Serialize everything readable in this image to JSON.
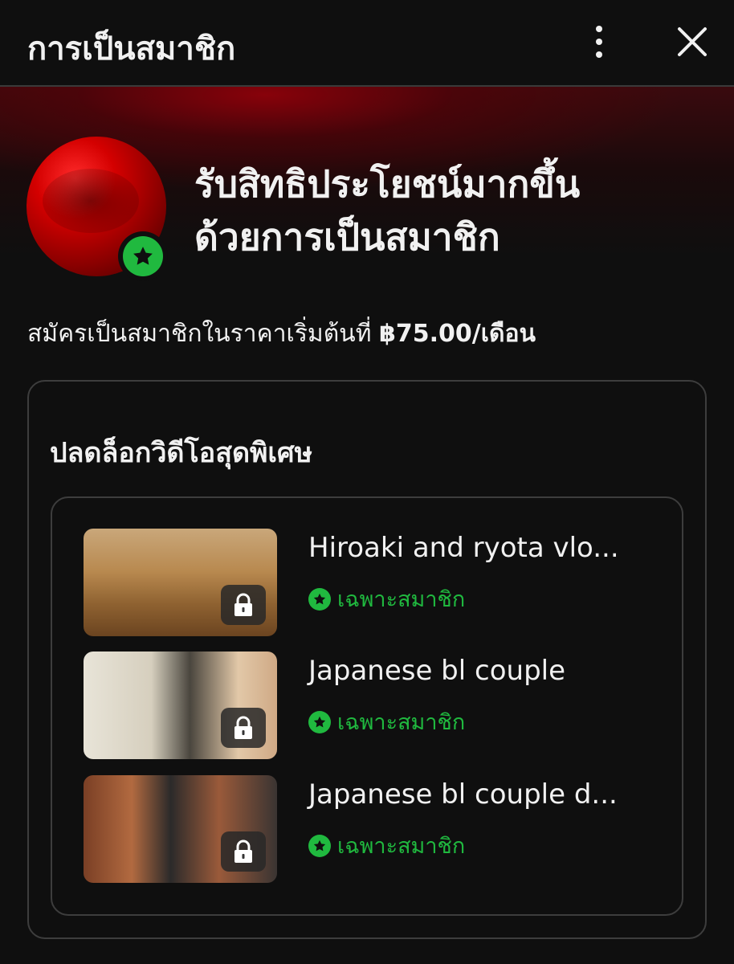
{
  "header": {
    "title": "การเป็นสมาชิก",
    "more_icon": "more-vertical-icon",
    "close_icon": "close-icon"
  },
  "hero": {
    "headline_line1": "รับสิทธิประโยชน์มากขึ้น",
    "headline_line2": "ด้วยการเป็นสมาชิก",
    "badge_icon": "star-icon"
  },
  "price": {
    "prefix": "สมัครเป็นสมาชิกในราคาเริ่มต้นที่ ",
    "amount": "฿75.00/เดือน"
  },
  "section": {
    "title": "ปลดล็อกวิดีโอสุดพิเศษ"
  },
  "videos": [
    {
      "title": "Hiroaki and ryota vlo...",
      "tag": "เฉพาะสมาชิก"
    },
    {
      "title": "Japanese bl couple",
      "tag": "เฉพาะสมาชิก"
    },
    {
      "title": "Japanese bl couple d...",
      "tag": "เฉพาะสมาชิก"
    }
  ],
  "colors": {
    "accent_green": "#20b93f",
    "background": "#0f0f0f",
    "hero_red": "#8a0000"
  }
}
